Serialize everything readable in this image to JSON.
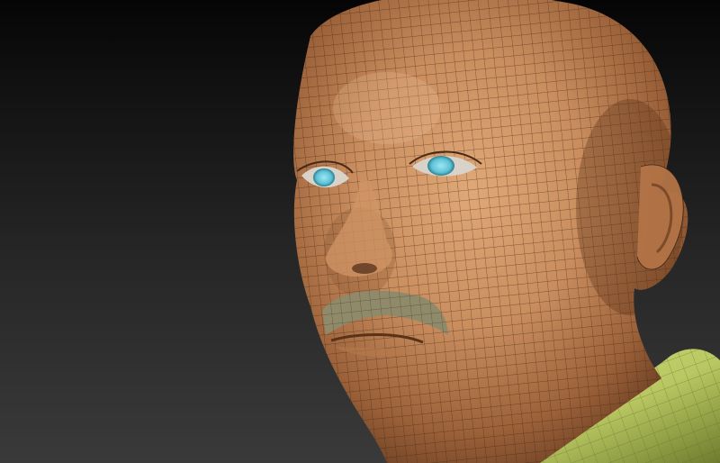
{
  "scene": {
    "subject": "bald-male-head-wireframe",
    "colors": {
      "background_top": "#050505",
      "background_bottom": "#3a3a3a",
      "skin": "#c98d5e",
      "skin_shadow": "#6b3f22",
      "wire": "#3b2416",
      "iris": "#5cc2d6",
      "mustache": "#8f8a6a",
      "shirt": "#b9c862",
      "shirt_shadow": "#6f7c2e"
    }
  }
}
